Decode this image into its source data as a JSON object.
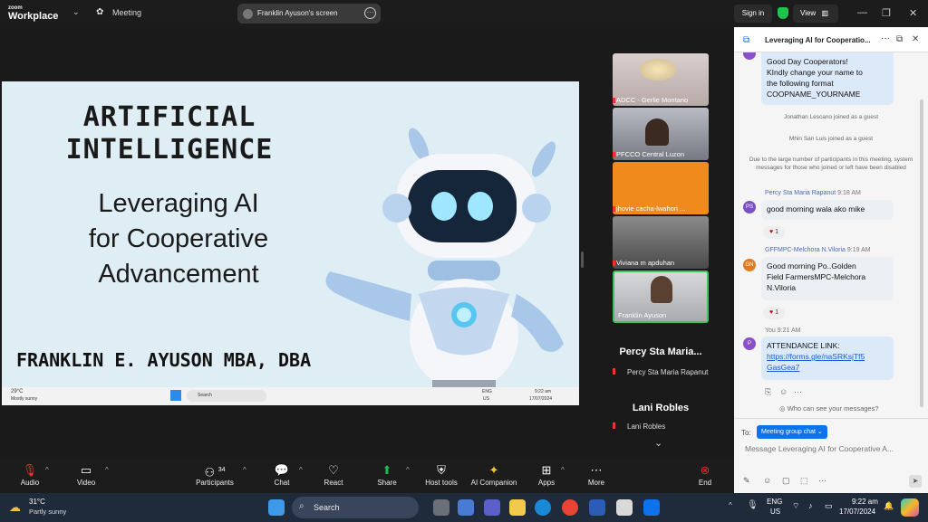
{
  "topbar": {
    "brand_top": "zoom",
    "brand": "Workplace",
    "meeting_label": "Meeting",
    "screen_label": "Franklin Ayuson's screen",
    "signin": "Sign in",
    "view": "View"
  },
  "slide": {
    "title": "ARTIFICIAL INTELLIGENCE",
    "subtitle_lines": [
      "Leveraging AI",
      "for Cooperative",
      "Advancement"
    ],
    "author": "FRANKLIN E. AYUSON MBA, DBA",
    "mini_taskbar": {
      "weather": "29°C",
      "weather_desc": "Mostly sunny",
      "search": "Search",
      "time": "9:22 am",
      "date": "17/07/2024",
      "lang": "ENG",
      "region": "US"
    }
  },
  "participants": [
    {
      "name": "ADCC - Gerlie Montano"
    },
    {
      "name": "PFCCO Central Luzon"
    },
    {
      "name": "jhovie cacha-lwahori ..."
    },
    {
      "name": "Viviana m apduhan"
    },
    {
      "name": "Franklin Ayuson"
    }
  ],
  "name_tiles": [
    {
      "big": "Percy Sta Maria...",
      "small": "Percy Sta Maria Rapanut"
    },
    {
      "big": "Lani Robles",
      "small": "Lani Robles"
    }
  ],
  "chat": {
    "title": "Leveraging AI for Cooperatio...",
    "first_msg_lines": [
      "Good Day Cooperators!",
      "KIndly change your name to",
      "the following format",
      "COOPNAME_YOURNAME"
    ],
    "sys1": "Jonathan Lescano joined as a guest",
    "sys2": "Mhin San Luis joined as a guest",
    "sys3": "Due to the large number of participants in this meeting, system messages for those who joined or left have been disabled",
    "msg1_sender": "Percy Sta Maria Rapanut",
    "msg1_time": "9:18 AM",
    "msg1_initials": "PS",
    "msg1_text": "good morning wala ako mike",
    "msg2_sender": "GFFMPC-Melchora N.Viloria",
    "msg2_time": "9:19 AM",
    "msg2_initials": "GN",
    "msg2_text_lines": [
      "Good morning Po..Golden",
      "Field FarmersMPC-Melchora",
      "N.Viloria"
    ],
    "msg3_sender": "You",
    "msg3_time": "9:21 AM",
    "msg3_initials": "P",
    "msg3_text": "ATTENDANCE LINK:",
    "msg3_link_lines": [
      "https://forms.gle/naSRKsjTf5",
      "GasGea7"
    ],
    "reaction_count": "1",
    "who_can_see": "Who can see your messages?",
    "to_label": "To:",
    "to_target": "Meeting group chat",
    "input_placeholder": "Message Leveraging AI for Cooperative A..."
  },
  "toolbar": {
    "audio": "Audio",
    "video": "Video",
    "participants": "Participants",
    "participants_count": "34",
    "chat": "Chat",
    "react": "React",
    "share": "Share",
    "host_tools": "Host tools",
    "ai_companion": "AI Companion",
    "apps": "Apps",
    "more": "More",
    "end": "End"
  },
  "taskbar": {
    "weather_temp": "31°C",
    "weather_desc": "Partly sunny",
    "search": "Search",
    "lang": "ENG",
    "region": "US",
    "time": "9:22 am",
    "date": "17/07/2024"
  },
  "colors": {
    "accent": "#0e72ed",
    "end": "#e02828",
    "share": "#1db954",
    "shield": "#1ec44c"
  }
}
